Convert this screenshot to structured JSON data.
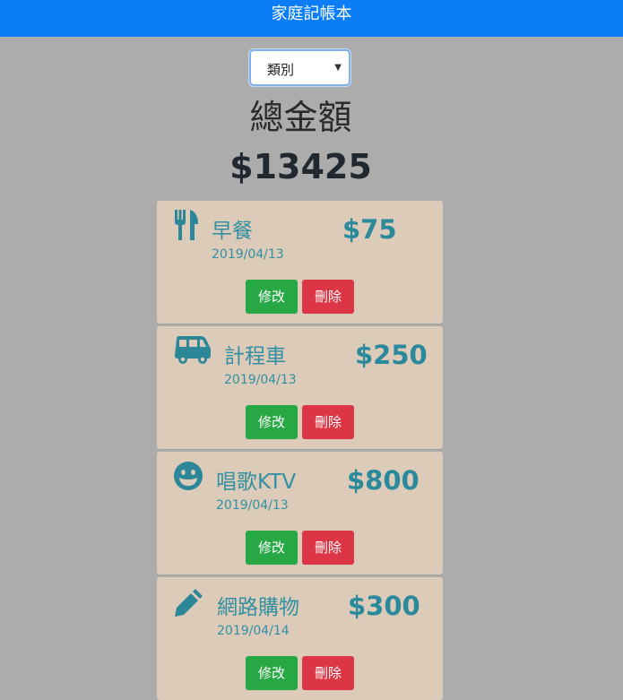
{
  "header": {
    "title": "家庭記帳本"
  },
  "filter": {
    "selected": "類別"
  },
  "summary": {
    "title": "總金額",
    "amount": "$13425"
  },
  "entries": [
    {
      "icon": "utensils-icon",
      "name": "早餐",
      "date": "2019/04/13",
      "amount": "$75",
      "edit_label": "修改",
      "delete_label": "刪除"
    },
    {
      "icon": "bus-icon",
      "name": "計程車",
      "date": "2019/04/13",
      "amount": "$250",
      "edit_label": "修改",
      "delete_label": "刪除"
    },
    {
      "icon": "grin-icon",
      "name": "唱歌KTV",
      "date": "2019/04/13",
      "amount": "$800",
      "edit_label": "修改",
      "delete_label": "刪除"
    },
    {
      "icon": "pencil-icon",
      "name": "網路購物",
      "date": "2019/04/14",
      "amount": "$300",
      "edit_label": "修改",
      "delete_label": "刪除"
    }
  ],
  "colors": {
    "header_bg": "#0a7df7",
    "page_bg": "#adacad",
    "card_bg": "#dccbb8",
    "accent_text": "#3290a2",
    "edit_button": "#28a745",
    "delete_button": "#dc3545"
  }
}
